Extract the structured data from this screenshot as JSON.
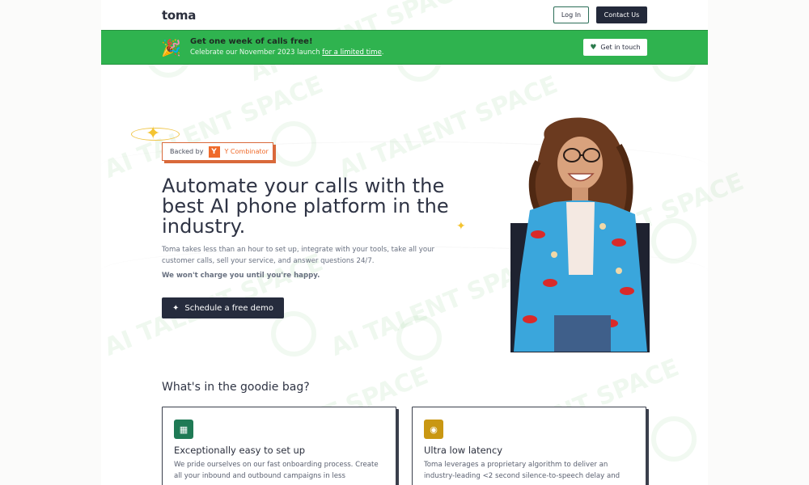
{
  "header": {
    "logo": "toma",
    "login_label": "Log In",
    "contact_label": "Contact Us"
  },
  "banner": {
    "icon": "party-popper-icon",
    "title": "Get one week of calls free!",
    "subtitle_prefix": "Celebrate our November 2023 launch ",
    "subtitle_link": "for a limited time",
    "subtitle_suffix": ".",
    "button_label": "Get in touch",
    "color": "#2fb34f"
  },
  "hero": {
    "backed_prefix": "Backed by",
    "backer_logo": "Y",
    "backer_name": "Y Combinator",
    "title": "Automate your calls with the best AI phone platform in the industry.",
    "description": "Toma takes less than an hour to set up, integrate with your tools, take all your customer calls, sell your service, and answer questions 24/7.",
    "note": "We won't charge you until you're happy.",
    "cta_label": "Schedule a free demo"
  },
  "goodies": {
    "title": "What's in the goodie bag?",
    "cards": [
      {
        "icon": "calculator-icon",
        "icon_color": "#1f7a55",
        "title": "Exceptionally easy to set up",
        "body": "We pride ourselves on our fast onboarding process. Create all your inbound and outbound campaigns in less"
      },
      {
        "icon": "timer-icon",
        "icon_color": "#c99712",
        "title": "Ultra low latency",
        "body": "Toma leverages a proprietary algorithm to deliver an industry-leading <2 second silence-to-speech delay and"
      }
    ]
  },
  "watermark": "AI TALENT SPACE"
}
